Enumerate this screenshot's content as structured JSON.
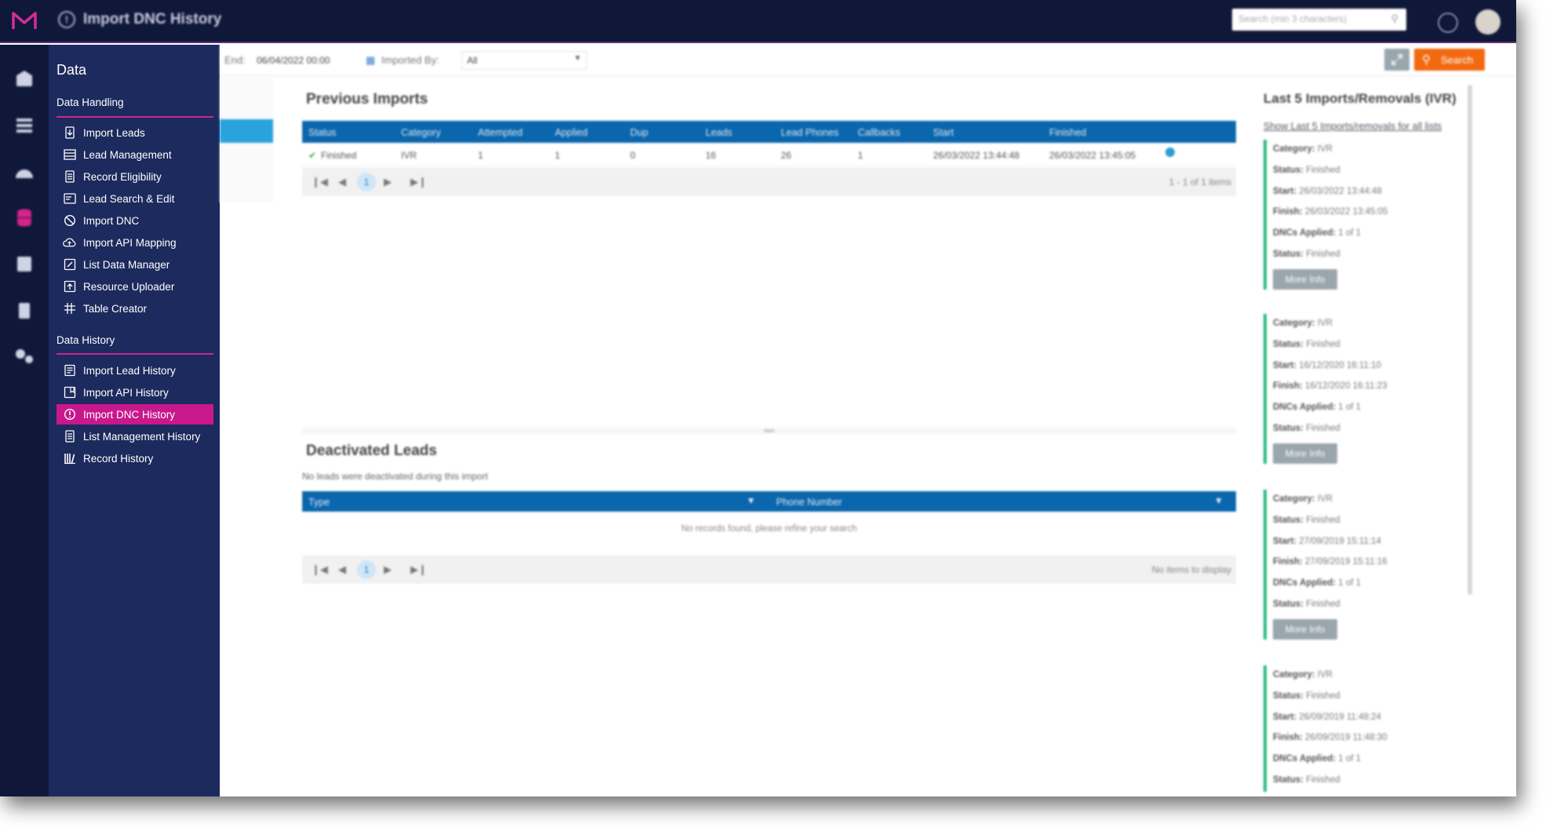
{
  "topbar": {
    "title": "Import DNC History",
    "search_placeholder": "Search (min 3 characters)"
  },
  "rail": {
    "icons": [
      "home-icon",
      "list-icon",
      "dashboard-icon",
      "database-icon",
      "contacts-icon",
      "document-icon",
      "settings-icon"
    ]
  },
  "sidebar": {
    "title": "Data",
    "data_handling_title": "Data Handling",
    "data_handling": [
      {
        "label": "Import Leads",
        "icon": "import-leads-icon"
      },
      {
        "label": "Lead Management",
        "icon": "lead-management-icon"
      },
      {
        "label": "Record Eligibility",
        "icon": "record-eligibility-icon"
      },
      {
        "label": "Lead Search & Edit",
        "icon": "lead-search-icon"
      },
      {
        "label": "Import DNC",
        "icon": "import-dnc-icon"
      },
      {
        "label": "Import API Mapping",
        "icon": "cloud-icon"
      },
      {
        "label": "List Data Manager",
        "icon": "edit-icon"
      },
      {
        "label": "Resource Uploader",
        "icon": "upload-icon"
      },
      {
        "label": "Table Creator",
        "icon": "table-icon"
      }
    ],
    "data_history_title": "Data History",
    "data_history": [
      {
        "label": "Import Lead History",
        "icon": "history-icon"
      },
      {
        "label": "Import API History",
        "icon": "api-history-icon"
      },
      {
        "label": "Import DNC History",
        "icon": "dnc-history-icon",
        "active": true
      },
      {
        "label": "List Management History",
        "icon": "list-history-icon"
      },
      {
        "label": "Record History",
        "icon": "record-history-icon"
      }
    ]
  },
  "filters": {
    "end_label": "End:",
    "end_value": "06/04/2022 00:00",
    "imported_by_label": "Imported By:",
    "imported_by_value": "All",
    "search_label": "Search"
  },
  "previous_imports": {
    "title": "Previous Imports",
    "columns": [
      "Status",
      "Category",
      "Attempted",
      "Applied",
      "Dup",
      "Leads",
      "Lead Phones",
      "Callbacks",
      "Start",
      "Finished"
    ],
    "rows": [
      [
        "Finished",
        "IVR",
        "1",
        "1",
        "0",
        "16",
        "26",
        "1",
        "26/03/2022 13:44:48",
        "26/03/2022 13:45:05"
      ]
    ],
    "pager_page": "1",
    "pager_info": "1 - 1 of 1 items"
  },
  "deactivated_leads": {
    "title": "Deactivated Leads",
    "subtitle": "No leads were deactivated during this import",
    "columns": [
      "Type",
      "Phone Number"
    ],
    "empty_text": "No records found, please refine your search",
    "pager_page": "1",
    "pager_info": "No items to display"
  },
  "right_panel": {
    "title": "Last 5 Imports/Removals (IVR)",
    "link": "Show Last 5 Imports/removals for all lists",
    "button_label": "More Info",
    "cards": [
      {
        "category": "IVR",
        "status": "Finished",
        "start": "26/03/2022 13:44:48",
        "finish": "26/03/2022 13:45:05",
        "dncs_applied": "1 of 1",
        "status2": "Finished"
      },
      {
        "category": "IVR",
        "status": "Finished",
        "start": "16/12/2020 16:11:10",
        "finish": "16/12/2020 16:11:23",
        "dncs_applied": "1 of 1",
        "status2": "Finished"
      },
      {
        "category": "IVR",
        "status": "Finished",
        "start": "27/09/2019 15:11:14",
        "finish": "27/09/2019 15:11:16",
        "dncs_applied": "1 of 1",
        "status2": "Finished"
      },
      {
        "category": "IVR",
        "status": "Finished",
        "start": "26/09/2019 11:48:24",
        "finish": "26/09/2019 11:48:30",
        "dncs_applied": "1 of 1",
        "status2": "Finished"
      }
    ]
  },
  "labels": {
    "category": "Category:",
    "status": "Status:",
    "start": "Start:",
    "finish": "Finish:",
    "dncs_applied": "DNCs Applied:"
  },
  "colors": {
    "topbar": "#10183a",
    "sidebar": "#1d2a5d",
    "accent_pink": "#c8188c",
    "grid_header": "#0a66ad",
    "search_button": "#f26a10",
    "card_border": "#2bb87a"
  }
}
